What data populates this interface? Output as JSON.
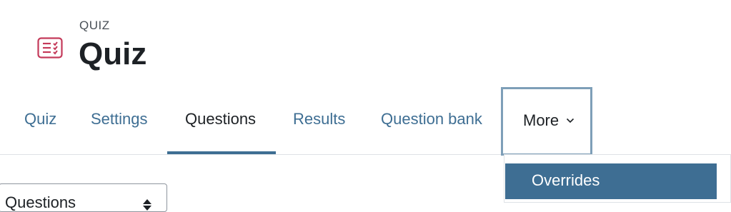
{
  "header": {
    "icon": "quiz-checklist-icon",
    "kicker": "QUIZ",
    "title": "Quiz"
  },
  "tabs": [
    {
      "label": "Quiz",
      "active": false
    },
    {
      "label": "Settings",
      "active": false
    },
    {
      "label": "Questions",
      "active": true
    },
    {
      "label": "Results",
      "active": false
    },
    {
      "label": "Question bank",
      "active": false
    }
  ],
  "more_tab": {
    "label": "More",
    "icon": "chevron-down-icon"
  },
  "dropdown": {
    "items": [
      {
        "label": "Overrides",
        "highlighted": true
      }
    ]
  },
  "question_select": {
    "value": "Questions",
    "icon": "caret-sort-icon"
  },
  "colors": {
    "link": "#3e6e93",
    "active_underline": "#3e6e93",
    "focus_border": "#7e9fb8",
    "icon_accent": "#ca3120"
  }
}
